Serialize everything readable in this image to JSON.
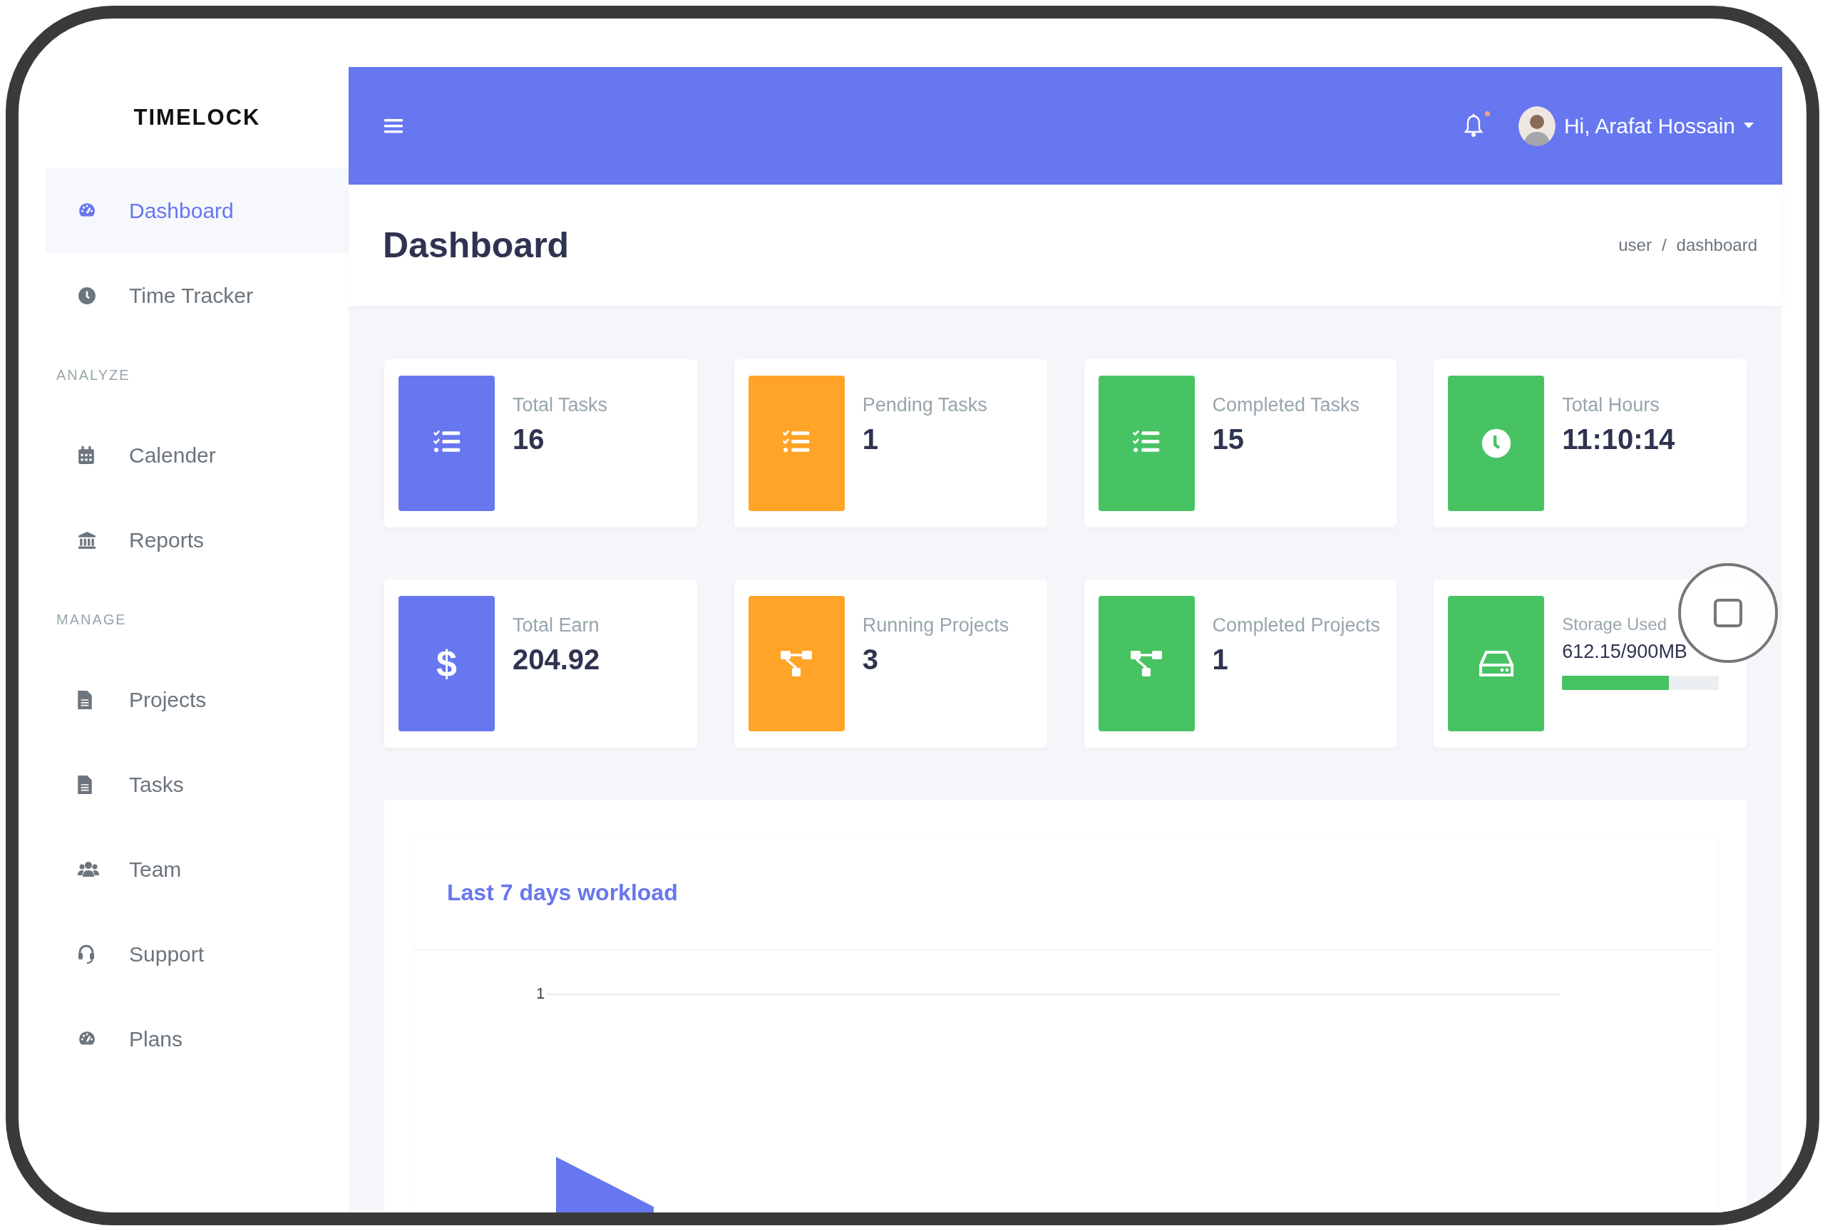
{
  "brand": "TIMELOCK",
  "sidebar": {
    "items": [
      {
        "kind": "link",
        "label": "Dashboard",
        "selected": true
      },
      {
        "kind": "link",
        "label": "Time Tracker",
        "selected": false
      },
      {
        "kind": "heading",
        "label": "ANALYZE"
      },
      {
        "kind": "link",
        "label": "Calender",
        "selected": false
      },
      {
        "kind": "link",
        "label": "Reports",
        "selected": false
      },
      {
        "kind": "heading",
        "label": "MANAGE"
      },
      {
        "kind": "link",
        "label": "Projects",
        "selected": false
      },
      {
        "kind": "link",
        "label": "Tasks",
        "selected": false
      },
      {
        "kind": "link",
        "label": "Team",
        "selected": false
      },
      {
        "kind": "link",
        "label": "Support",
        "selected": false
      },
      {
        "kind": "link",
        "label": "Plans",
        "selected": false
      }
    ]
  },
  "header": {
    "user": "Hi, Arafat Hossain",
    "unread": true
  },
  "page": {
    "title": "Dashboard",
    "breadcrumb": [
      "user",
      "dashboard"
    ],
    "separator": "/"
  },
  "stats": [
    {
      "kind": "tasks",
      "label": "Total Tasks",
      "value": "16",
      "color": "#6777ef"
    },
    {
      "kind": "tasks",
      "label": "Pending Tasks",
      "value": "1",
      "color": "#ffa426"
    },
    {
      "kind": "tasks",
      "label": "Completed Tasks",
      "value": "15",
      "color": "#47c363"
    },
    {
      "kind": "time",
      "label": "Total Hours",
      "value": "11:10:14",
      "color": "#47c363"
    },
    {
      "kind": "money",
      "label": "Total Earn",
      "value": "204.92",
      "color": "#6777ef",
      "symbol": "$"
    },
    {
      "kind": "projects",
      "label": "Running Projects",
      "value": "3",
      "color": "#ffa426"
    },
    {
      "kind": "projects",
      "label": "Completed Projects",
      "value": "1",
      "color": "#47c363"
    },
    {
      "kind": "storage",
      "label": "Storage Used",
      "value": "612.15/900MB",
      "color": "#47c363",
      "level": 0.68
    }
  ],
  "workload": {
    "title": "Last 7 days workload",
    "y_axis_label": "1"
  }
}
